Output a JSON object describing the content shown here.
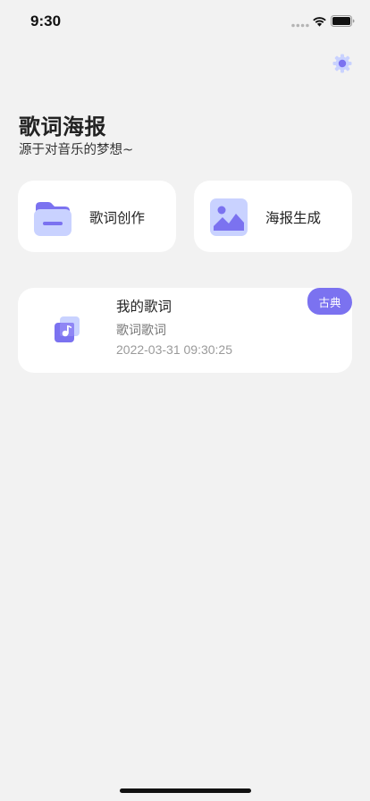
{
  "status_bar": {
    "time": "9:30",
    "icons": [
      "cellular-icon",
      "wifi-icon",
      "battery-icon"
    ]
  },
  "header": {
    "settings_icon": "gear-icon",
    "title": "歌词海报",
    "subtitle": "源于对音乐的梦想~"
  },
  "features": [
    {
      "label": "歌词创作",
      "icon": "folder-icon"
    },
    {
      "label": "海报生成",
      "icon": "image-icon"
    }
  ],
  "song": {
    "title": "我的歌词",
    "subtitle": "歌词歌词",
    "timestamp": "2022-03-31 09:30:25",
    "genre": "古典",
    "icon": "music-note-icon"
  },
  "colors": {
    "accent": "#7b72f0",
    "accent_light": "#c9d2ff",
    "background": "#f2f2f2",
    "card": "#ffffff"
  }
}
